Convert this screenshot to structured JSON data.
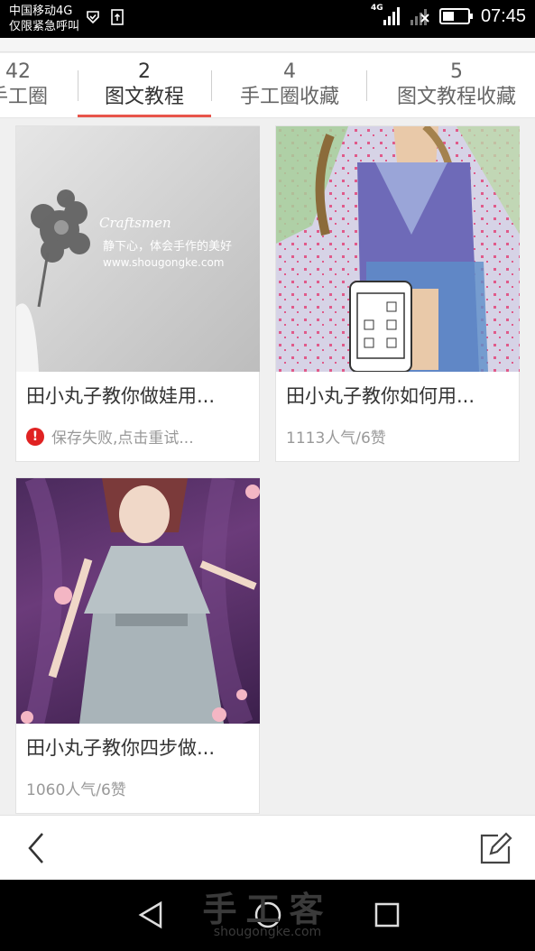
{
  "status_bar": {
    "carrier_line1": "中国移动4G",
    "carrier_line2": "仅限紧急呼叫",
    "network_badge": "4G",
    "time": "07:45",
    "icons": [
      "shield-check-icon",
      "sim-upload-icon",
      "signal-icon",
      "signal-empty-icon",
      "battery-icon"
    ]
  },
  "tabs": [
    {
      "count": "42",
      "label": "手工圈"
    },
    {
      "count": "2",
      "label": "图文教程",
      "active": true
    },
    {
      "count": "4",
      "label": "手工圈收藏"
    },
    {
      "count": "5",
      "label": "图文教程收藏"
    }
  ],
  "cards": [
    {
      "title": "田小丸子教你做娃用...",
      "meta": "保存失败,点击重试...",
      "error": true,
      "image": {
        "brand": "Craftsmen",
        "slogan": "静下心，体会手作的美好",
        "url": "www.shougongke.com"
      }
    },
    {
      "title": "田小丸子教你如何用...",
      "meta": "1113人气/6赞",
      "error": false
    },
    {
      "title": "田小丸子教你四步做...",
      "meta": "1060人气/6赞",
      "error": false
    }
  ],
  "bottom_bar": {
    "icons": [
      "back-chevron-icon",
      "edit-icon"
    ]
  },
  "nav_bar": {
    "icons": [
      "nav-back-icon",
      "nav-home-icon",
      "nav-recent-icon"
    ]
  },
  "watermark": {
    "text": "手工客",
    "url": "shougongke.com"
  }
}
